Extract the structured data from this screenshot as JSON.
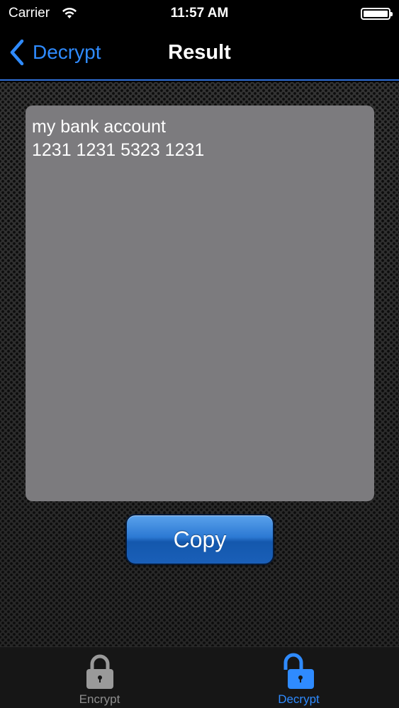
{
  "status_bar": {
    "carrier": "Carrier",
    "time": "11:57 AM",
    "wifi_icon": "wifi-icon",
    "battery_icon": "battery-icon"
  },
  "nav": {
    "back_label": "Decrypt",
    "title": "Result",
    "accent_color": "#2f8bff"
  },
  "result": {
    "text": "my bank account\n1231 1231 5323 1231"
  },
  "actions": {
    "copy_label": "Copy"
  },
  "tabs": [
    {
      "label": "Encrypt",
      "icon": "lock-closed-icon",
      "selected": false
    },
    {
      "label": "Decrypt",
      "icon": "lock-open-icon",
      "selected": true
    }
  ]
}
